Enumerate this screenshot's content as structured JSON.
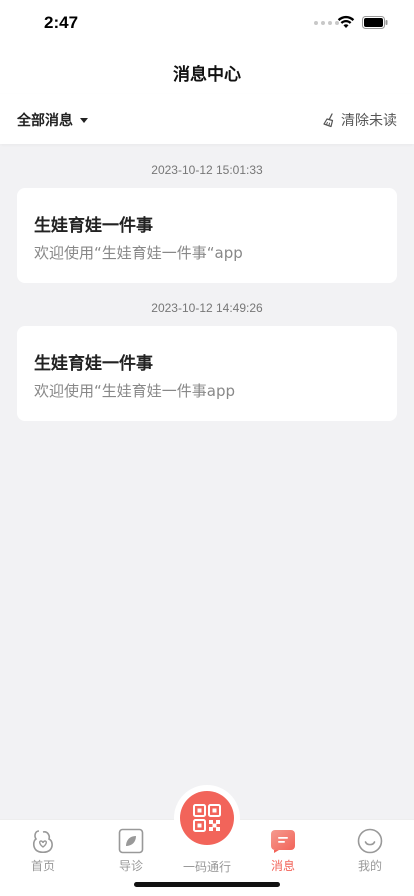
{
  "status": {
    "time": "2:47"
  },
  "nav": {
    "title": "消息中心"
  },
  "filter": {
    "label": "全部消息",
    "clear_label": "清除未读"
  },
  "messages": [
    {
      "time": "2023-10-12 15:01:33",
      "title": "生娃育娃一件事",
      "body": "欢迎使用“生娃育娃一件事“app"
    },
    {
      "time": "2023-10-12 14:49:26",
      "title": "生娃育娃一件事",
      "body": "欢迎使用“生娃育娃一件事app"
    }
  ],
  "tabs": [
    {
      "label": "首页",
      "icon": "home-icon"
    },
    {
      "label": "导诊",
      "icon": "guide-icon"
    },
    {
      "label": "一码通行",
      "icon": "qr-code-icon"
    },
    {
      "label": "消息",
      "icon": "message-icon",
      "active": true
    },
    {
      "label": "我的",
      "icon": "profile-icon"
    }
  ],
  "colors": {
    "accent": "#f2645a",
    "background": "#f2f2f4"
  }
}
